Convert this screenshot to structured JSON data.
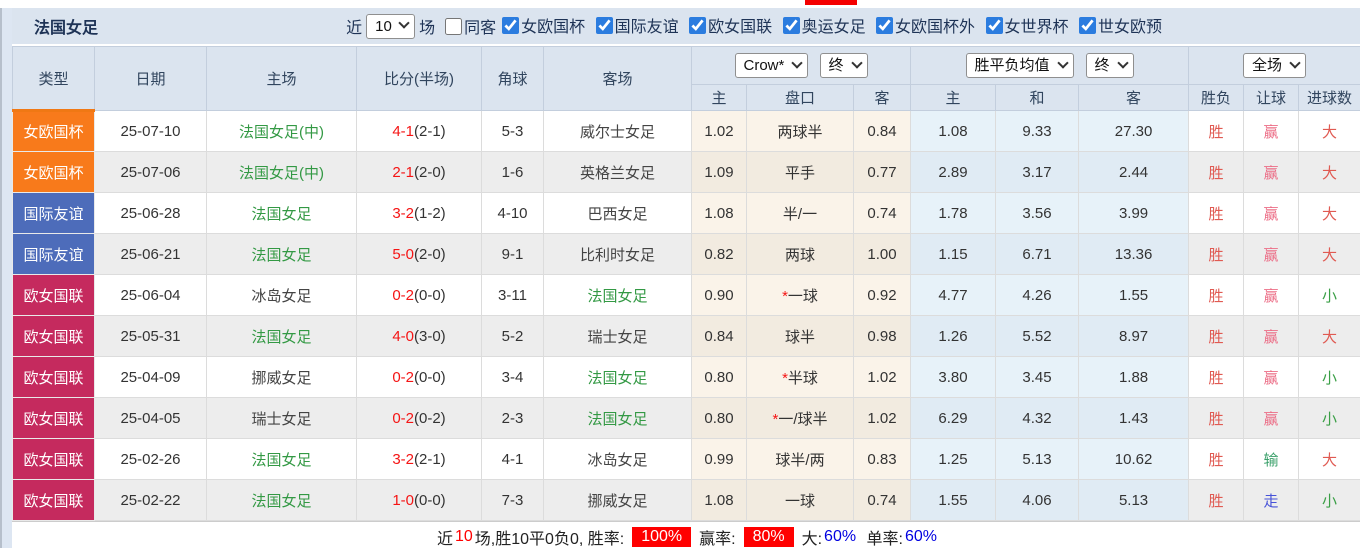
{
  "top": {
    "title": "法国女足",
    "recent_label": "近",
    "recent_value": "10",
    "recent_suffix": "场",
    "same_away": {
      "label": "同客",
      "checked": false
    },
    "filters": [
      {
        "label": "女欧国杯",
        "checked": true
      },
      {
        "label": "国际友谊",
        "checked": true
      },
      {
        "label": "欧女国联",
        "checked": true
      },
      {
        "label": "奥运女足",
        "checked": true
      },
      {
        "label": "女欧国杯外",
        "checked": true
      },
      {
        "label": "女世界杯",
        "checked": true
      },
      {
        "label": "世女欧预",
        "checked": true
      }
    ]
  },
  "table": {
    "col_headers": {
      "type": "类型",
      "date": "日期",
      "home": "主场",
      "score": "比分(半场)",
      "corner": "角球",
      "away": "客场"
    },
    "selects": {
      "company": "Crow*",
      "company_state": "终",
      "avg": "胜平负均值",
      "avg_state": "终",
      "scope": "全场"
    },
    "sub_headers": {
      "odds_home": "主",
      "handicap": "盘口",
      "odds_away": "客",
      "avg_home": "主",
      "avg_draw": "和",
      "avg_away": "客",
      "result": "胜负",
      "handicap_result": "让球",
      "goals_result": "进球数"
    },
    "rows": [
      {
        "league": "女欧国杯",
        "date": "25-07-10",
        "home": "法国女足(中)",
        "score": "4-1",
        "half": "(2-1)",
        "corner": "5-3",
        "away": "威尔士女足",
        "odds_home": "1.02",
        "star": "",
        "handicap": "两球半",
        "odds_away": "0.84",
        "avg_home": "1.08",
        "avg_draw": "9.33",
        "avg_away": "27.30",
        "result": "胜",
        "handicap_result": "赢",
        "goals_result": "大"
      },
      {
        "league": "女欧国杯",
        "date": "25-07-06",
        "home": "法国女足(中)",
        "score": "2-1",
        "half": "(2-0)",
        "corner": "1-6",
        "away": "英格兰女足",
        "odds_home": "1.09",
        "star": "",
        "handicap": "平手",
        "odds_away": "0.77",
        "avg_home": "2.89",
        "avg_draw": "3.17",
        "avg_away": "2.44",
        "result": "胜",
        "handicap_result": "赢",
        "goals_result": "大"
      },
      {
        "league": "国际友谊",
        "date": "25-06-28",
        "home": "法国女足",
        "score": "3-2",
        "half": "(1-2)",
        "corner": "4-10",
        "away": "巴西女足",
        "odds_home": "1.08",
        "star": "",
        "handicap": "半/一",
        "odds_away": "0.74",
        "avg_home": "1.78",
        "avg_draw": "3.56",
        "avg_away": "3.99",
        "result": "胜",
        "handicap_result": "赢",
        "goals_result": "大"
      },
      {
        "league": "国际友谊",
        "date": "25-06-21",
        "home": "法国女足",
        "score": "5-0",
        "half": "(2-0)",
        "corner": "9-1",
        "away": "比利时女足",
        "odds_home": "0.82",
        "star": "",
        "handicap": "两球",
        "odds_away": "1.00",
        "avg_home": "1.15",
        "avg_draw": "6.71",
        "avg_away": "13.36",
        "result": "胜",
        "handicap_result": "赢",
        "goals_result": "大"
      },
      {
        "league": "欧女国联",
        "date": "25-06-04",
        "home": "冰岛女足",
        "score": "0-2",
        "half": "(0-0)",
        "corner": "3-11",
        "away": "法国女足",
        "odds_home": "0.90",
        "star": "*",
        "handicap": "一球",
        "odds_away": "0.92",
        "avg_home": "4.77",
        "avg_draw": "4.26",
        "avg_away": "1.55",
        "result": "胜",
        "handicap_result": "赢",
        "goals_result": "小"
      },
      {
        "league": "欧女国联",
        "date": "25-05-31",
        "home": "法国女足",
        "score": "4-0",
        "half": "(3-0)",
        "corner": "5-2",
        "away": "瑞士女足",
        "odds_home": "0.84",
        "star": "",
        "handicap": "球半",
        "odds_away": "0.98",
        "avg_home": "1.26",
        "avg_draw": "5.52",
        "avg_away": "8.97",
        "result": "胜",
        "handicap_result": "赢",
        "goals_result": "大"
      },
      {
        "league": "欧女国联",
        "date": "25-04-09",
        "home": "挪威女足",
        "score": "0-2",
        "half": "(0-0)",
        "corner": "3-4",
        "away": "法国女足",
        "odds_home": "0.80",
        "star": "*",
        "handicap": "半球",
        "odds_away": "1.02",
        "avg_home": "3.80",
        "avg_draw": "3.45",
        "avg_away": "1.88",
        "result": "胜",
        "handicap_result": "赢",
        "goals_result": "小"
      },
      {
        "league": "欧女国联",
        "date": "25-04-05",
        "home": "瑞士女足",
        "score": "0-2",
        "half": "(0-2)",
        "corner": "2-3",
        "away": "法国女足",
        "odds_home": "0.80",
        "star": "*",
        "handicap": "一/球半",
        "odds_away": "1.02",
        "avg_home": "6.29",
        "avg_draw": "4.32",
        "avg_away": "1.43",
        "result": "胜",
        "handicap_result": "赢",
        "goals_result": "小"
      },
      {
        "league": "欧女国联",
        "date": "25-02-26",
        "home": "法国女足",
        "score": "3-2",
        "half": "(2-1)",
        "corner": "4-1",
        "away": "冰岛女足",
        "odds_home": "0.99",
        "star": "",
        "handicap": "球半/两",
        "odds_away": "0.83",
        "avg_home": "1.25",
        "avg_draw": "5.13",
        "avg_away": "10.62",
        "result": "胜",
        "handicap_result": "输",
        "goals_result": "大"
      },
      {
        "league": "欧女国联",
        "date": "25-02-22",
        "home": "法国女足",
        "score": "1-0",
        "half": "(0-0)",
        "corner": "7-3",
        "away": "挪威女足",
        "odds_home": "1.08",
        "star": "",
        "handicap": "一球",
        "odds_away": "0.74",
        "avg_home": "1.55",
        "avg_draw": "4.06",
        "avg_away": "5.13",
        "result": "胜",
        "handicap_result": "走",
        "goals_result": "小"
      }
    ]
  },
  "summary": {
    "prefix": "近",
    "count": "10",
    "middle": "场,胜10平0负0, 胜率:",
    "win_rate": "100%",
    "rang_label": "赢率:",
    "rang_rate": "80%",
    "big_label": "大:",
    "big_rate": "60%",
    "space": " ",
    "single_label": "单率:",
    "single_rate": "60%"
  },
  "colors": {
    "league": {
      "女欧国杯": "#f87a1b",
      "国际友谊": "#4d6cba",
      "欧女国联": "#c52a5e"
    },
    "result": {
      "胜": "#e05a52",
      "赢": "#ec6d86",
      "输": "#3aa06a",
      "走": "#4753d8",
      "大": "#e05a52",
      "小": "#3a9f46"
    },
    "team_highlight": "#339944",
    "score_red": "#f51414",
    "highlight_red": "#ff0000",
    "percent_blue": "#0000e0"
  }
}
